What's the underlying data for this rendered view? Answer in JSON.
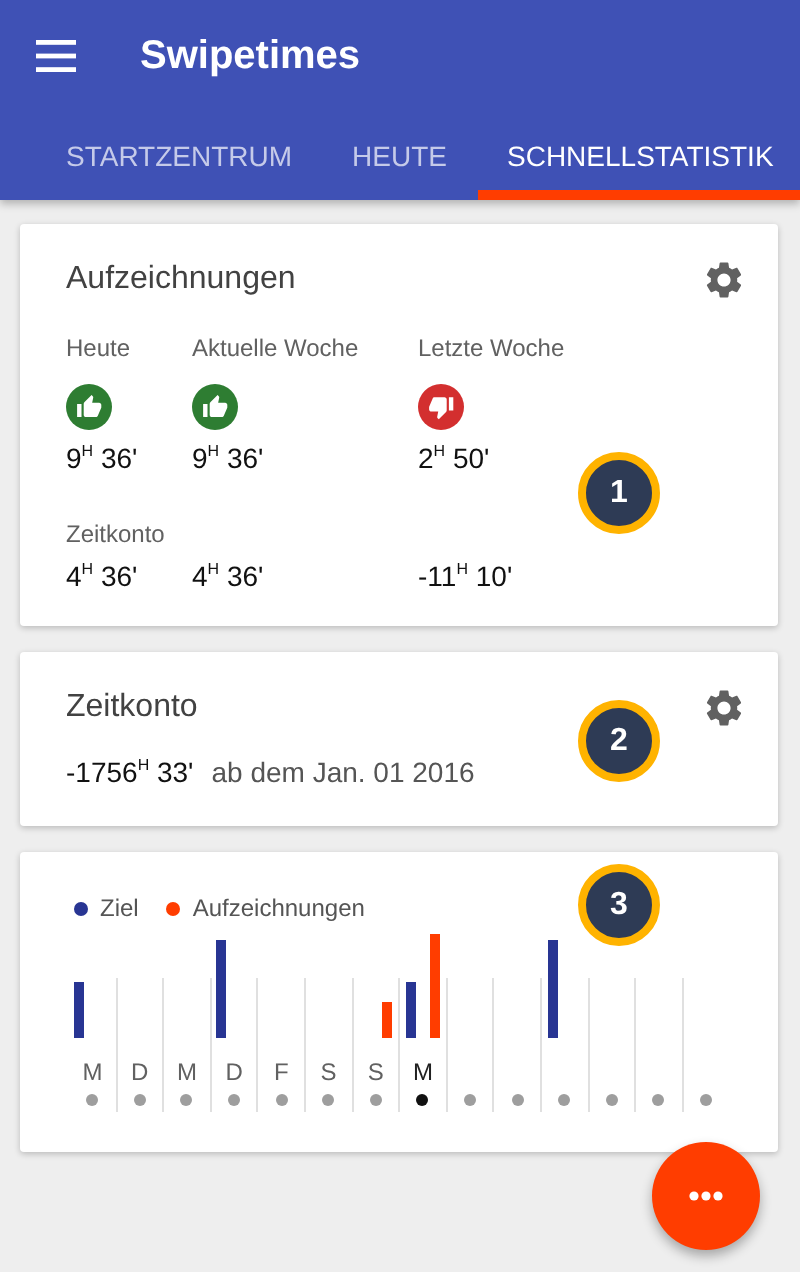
{
  "app_bar": {
    "title": "Swipetimes"
  },
  "tabs": [
    {
      "label": "STARTZENTRUM",
      "selected": false
    },
    {
      "label": "HEUTE",
      "selected": false
    },
    {
      "label": "SCHNELLSTATISTIK",
      "selected": true
    }
  ],
  "records_card": {
    "title": "Aufzeichnungen",
    "badge": "1",
    "balance_label": "Zeitkonto",
    "columns": [
      {
        "label": "Heute",
        "kind": "up",
        "value": "9$^{H}$ 36'",
        "balance": "4$^{H}$ 36'"
      },
      {
        "label": "Aktuelle Woche",
        "kind": "up",
        "value": "9$^{H}$ 36'",
        "balance": "4$^{H}$ 36'"
      },
      {
        "label": "Letzte Woche",
        "kind": "down",
        "value": "2$^{H}$ 50'",
        "balance": "-11$^{H}$ 10'"
      }
    ]
  },
  "balance_card": {
    "title": "Zeitkonto",
    "badge": "2",
    "value": "-1756$^{H}$ 33'",
    "since": "ab dem Jan. 01 2016"
  },
  "chart_card": {
    "badge": "3",
    "legend": [
      {
        "label": "Ziel",
        "color": "#283593"
      },
      {
        "label": "Aufzeichnungen",
        "color": "#ff3d00"
      }
    ],
    "days": [
      {
        "label": "M",
        "selected": false
      },
      {
        "label": "D",
        "selected": false
      },
      {
        "label": "M",
        "selected": false
      },
      {
        "label": "D",
        "selected": false
      },
      {
        "label": "F",
        "selected": false
      },
      {
        "label": "S",
        "selected": false
      },
      {
        "label": "S",
        "selected": false
      },
      {
        "label": "M",
        "selected": true
      },
      {
        "selected": false
      },
      {
        "selected": false
      },
      {
        "selected": false
      },
      {
        "selected": false
      },
      {
        "selected": false
      },
      {
        "selected": false
      }
    ]
  }
}
